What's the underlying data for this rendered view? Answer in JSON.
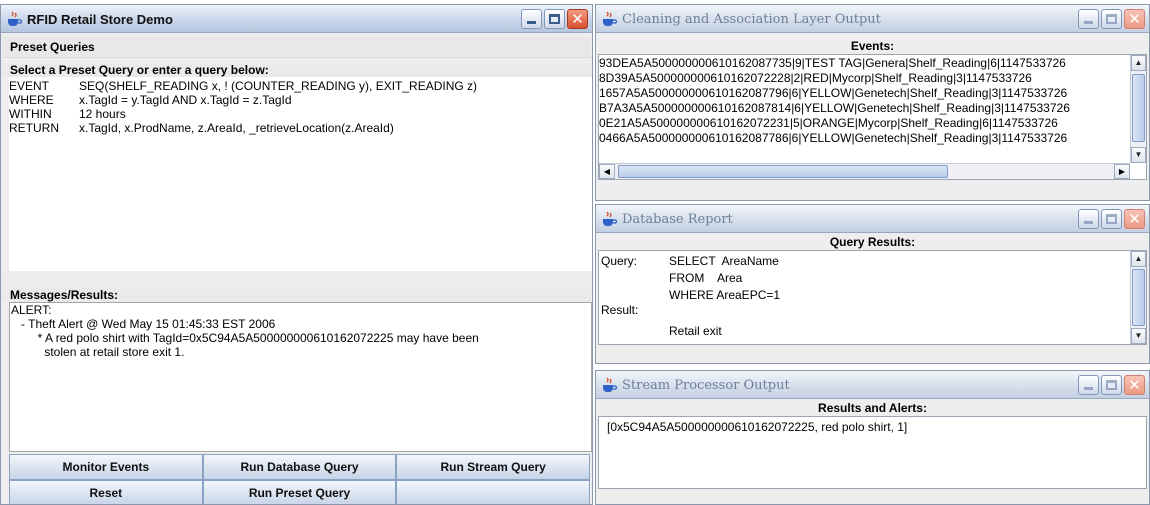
{
  "colors": {
    "title_bar": "#cad6ea",
    "button_face": "#d7e1ef",
    "close_button": "#d9502f"
  },
  "main_window": {
    "title": "RFID Retail Store Demo",
    "preset_header": "Preset Queries",
    "query_prompt": "Select a Preset Query or enter a query below:",
    "query_lines": [
      {
        "keyword": "EVENT",
        "text": "SEQ(SHELF_READING x, ! (COUNTER_READING y),  EXIT_READING z)"
      },
      {
        "keyword": "WHERE",
        "text": "x.TagId = y.TagId AND x.TagId = z.TagId"
      },
      {
        "keyword": "WITHIN",
        "text": "12 hours"
      },
      {
        "keyword": "RETURN",
        "text": "x.TagId, x.ProdName, z.AreaId, _retrieveLocation(z.AreaId)"
      }
    ],
    "messages_header": "Messages/Results:",
    "messages": [
      "ALERT:",
      "   - Theft Alert @ Wed May 15 01:45:33 EST 2006",
      "        * A red polo shirt with TagId=0x5C94A5A500000000610162072225 may have been",
      "          stolen at retail store exit 1."
    ],
    "buttons": {
      "monitor_events": "Monitor Events",
      "run_database_query": "Run Database Query",
      "run_stream_query": "Run Stream Query",
      "reset": "Reset",
      "run_preset_query": "Run Preset Query"
    }
  },
  "cleaning_window": {
    "title": "Cleaning and Association Layer Output",
    "header": "Events:",
    "events": [
      "93DEA5A500000000610162087735|9|TEST TAG|Genera|Shelf_Reading|6|1147533726",
      "8D39A5A500000000610162072228|2|RED|Mycorp|Shelf_Reading|3|1147533726",
      "1657A5A500000000610162087796|6|YELLOW|Genetech|Shelf_Reading|3|1147533726",
      "B7A3A5A500000000610162087814|6|YELLOW|Genetech|Shelf_Reading|3|1147533726",
      "0E21A5A500000000610162072231|5|ORANGE|Mycorp|Shelf_Reading|6|1147533726",
      "0466A5A500000000610162087786|6|YELLOW|Genetech|Shelf_Reading|3|1147533726"
    ]
  },
  "database_window": {
    "title": "Database Report",
    "header": "Query Results:",
    "query_label": "Query:",
    "query_lines": [
      "SELECT  AreaName",
      "FROM    Area",
      "WHERE AreaEPC=1"
    ],
    "result_label": "Result:",
    "result_value": "Retail exit"
  },
  "stream_window": {
    "title": "Stream Processor Output",
    "header": "Results and Alerts:",
    "result": "[0x5C94A5A500000000610162072225, red polo shirt, 1]"
  }
}
